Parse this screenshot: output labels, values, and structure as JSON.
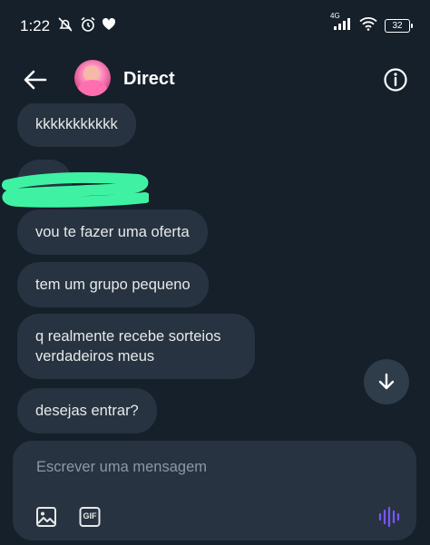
{
  "status_bar": {
    "time": "1:22",
    "network": "4G",
    "battery": "32"
  },
  "header": {
    "title": "Direct"
  },
  "messages": [
    {
      "text": "kkkkkkkkkkk"
    },
    {
      "text": "vou te fazer uma oferta"
    },
    {
      "text": "tem um grupo pequeno"
    },
    {
      "text": "q realmente recebe sorteios verdadeiros meus"
    },
    {
      "text": "desejas entrar?"
    }
  ],
  "composer": {
    "placeholder": "Escrever uma mensagem",
    "gif_label": "GIF"
  },
  "colors": {
    "background": "#15202b",
    "bubble": "#273340",
    "text": "#e7e9ea",
    "voice_accent": "#7856ff",
    "redaction": "#3ff2a3"
  },
  "icons": [
    "back-arrow-icon",
    "info-icon",
    "image-icon",
    "gif-icon",
    "voice-wave-icon",
    "arrow-down-icon",
    "dnd-icon",
    "alarm-icon",
    "heart-icon",
    "signal-icon",
    "wifi-icon",
    "battery-icon"
  ]
}
